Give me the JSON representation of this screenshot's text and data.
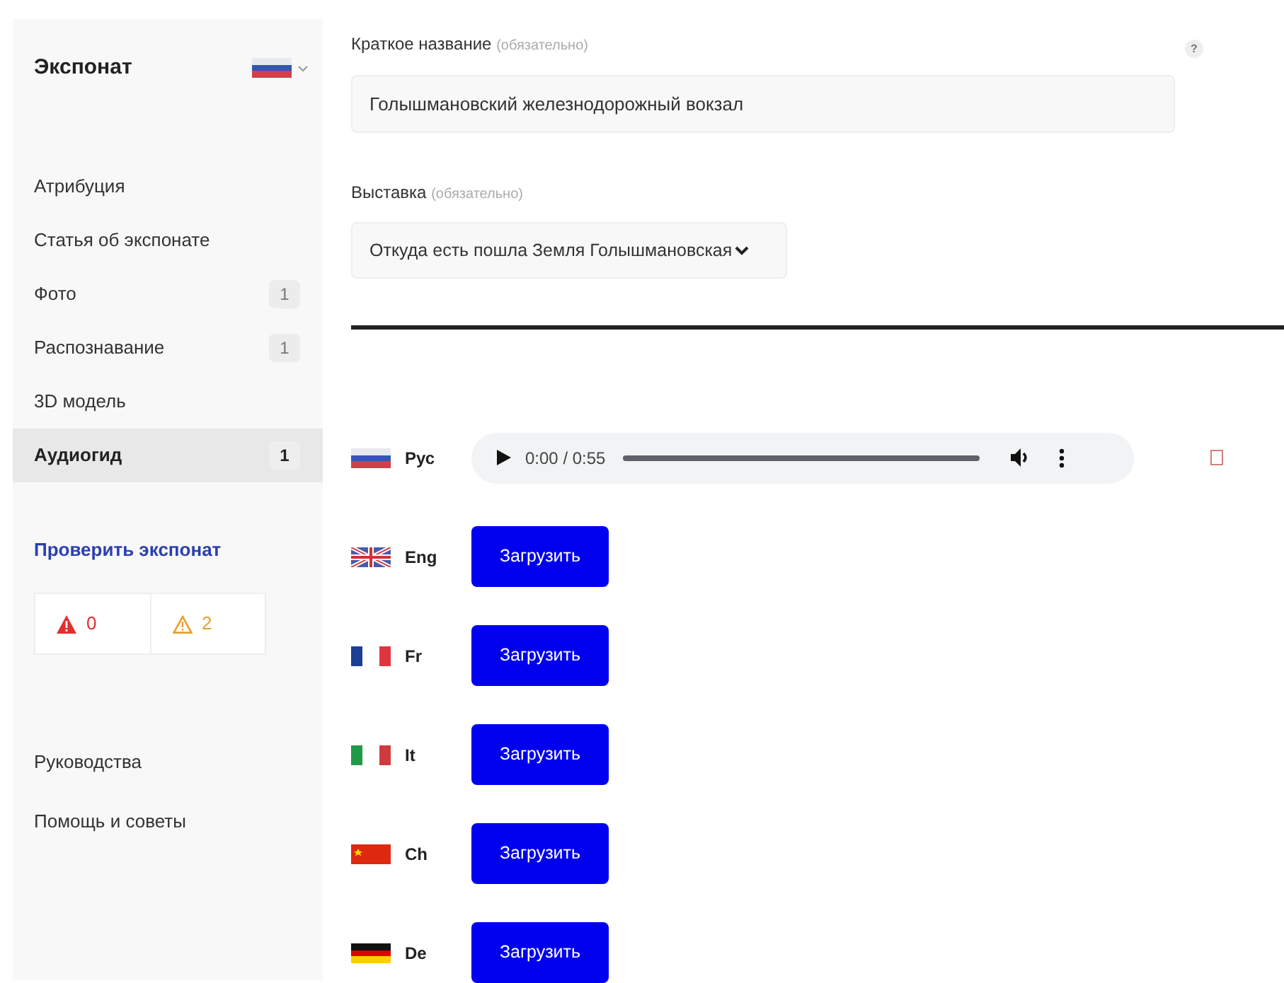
{
  "sidebar": {
    "title": "Экспонат",
    "items": [
      {
        "label": "Атрибуция",
        "selected": false
      },
      {
        "label": "Статья об экспонате",
        "selected": false
      },
      {
        "label": "Фото",
        "badge": "1",
        "selected": false
      },
      {
        "label": "Распознавание",
        "badge": "1",
        "selected": false
      },
      {
        "label": "3D модель",
        "selected": false
      },
      {
        "label": "Аудиогид",
        "badge": "1",
        "selected": true
      }
    ],
    "check_link": "Проверить экспонат",
    "checks": [
      {
        "kind": "error",
        "count": "0"
      },
      {
        "kind": "warning",
        "count": "2"
      }
    ],
    "footer_links": [
      "Руководства",
      "Помощь и советы"
    ]
  },
  "fields": [
    {
      "kind": "input",
      "label": "Краткое название",
      "hint": "(обязательно)",
      "value": "Голышмановский железнодорожный вокзал",
      "help": "?"
    },
    {
      "kind": "select",
      "label": "Выставка",
      "hint": "(обязательно)",
      "value": "Откуда есть пошла Земля Голышмановская"
    }
  ],
  "audio": [
    {
      "lang": "Рус",
      "flag": {
        "kind": "ru"
      },
      "kind": "player",
      "time": "0:00 / 0:55"
    },
    {
      "lang": "Eng",
      "flag": {
        "kind": "gb"
      },
      "kind": "upload",
      "button": "Загрузить"
    },
    {
      "lang": "Fr",
      "flag": {
        "kind": "fr"
      },
      "kind": "upload",
      "button": "Загрузить"
    },
    {
      "lang": "It",
      "flag": {
        "kind": "it"
      },
      "kind": "upload",
      "button": "Загрузить"
    },
    {
      "lang": "Ch",
      "flag": {
        "kind": "cn"
      },
      "kind": "upload",
      "button": "Загрузить"
    },
    {
      "lang": "De",
      "flag": {
        "kind": "de"
      },
      "kind": "upload",
      "button": "Загрузить"
    }
  ]
}
